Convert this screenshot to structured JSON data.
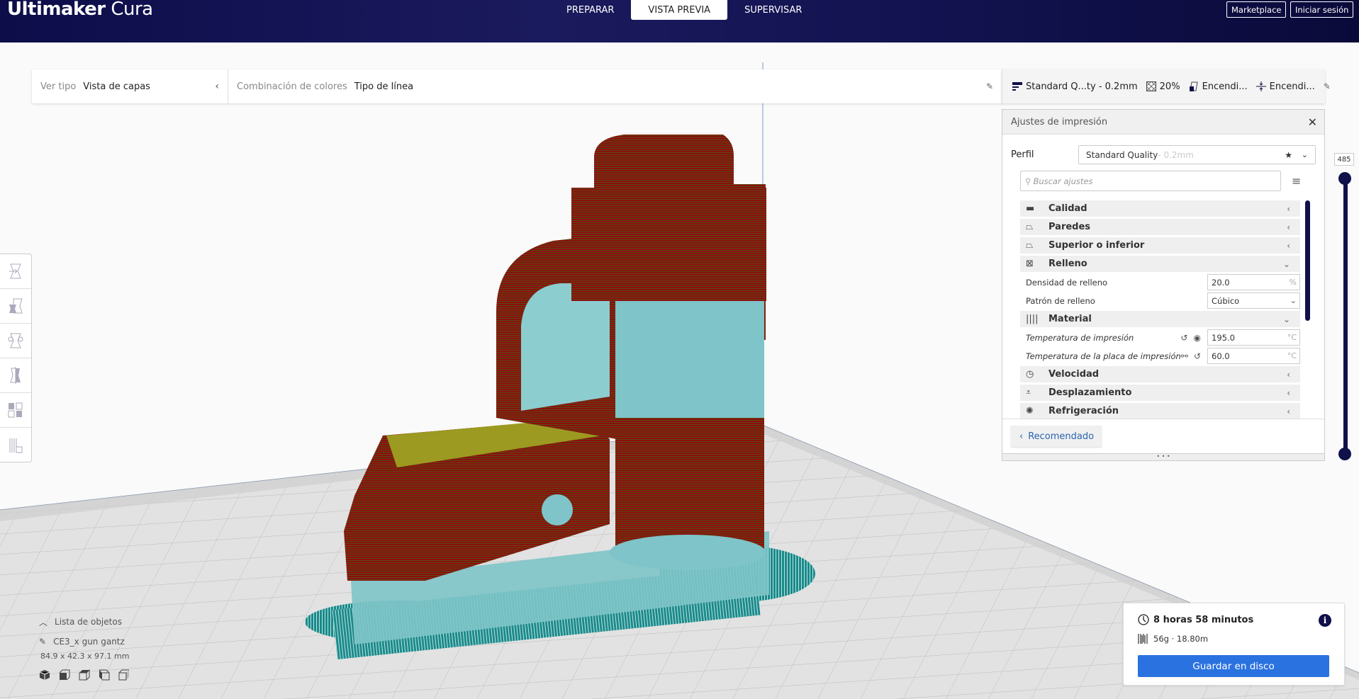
{
  "app": {
    "title_bold": "Ultimaker",
    "title_light": "Cura"
  },
  "stages": [
    {
      "label": "PREPARAR",
      "active": false
    },
    {
      "label": "VISTA PREVIA",
      "active": true
    },
    {
      "label": "SUPERVISAR",
      "active": false
    }
  ],
  "header_buttons": {
    "marketplace": "Marketplace",
    "login": "Iniciar sesión"
  },
  "view_bar": {
    "view_type_label": "Ver tipo",
    "view_type_value": "Vista de capas",
    "color_scheme_label": "Combinación de colores",
    "color_scheme_value": "Tipo de línea"
  },
  "settings_bar": {
    "profile": "Standard Q...ty - 0.2mm",
    "infill": "20%",
    "support": "Encendi...",
    "adhesion": "Encendi..."
  },
  "print_settings": {
    "title": "Ajustes de impresión",
    "profile_label": "Perfil",
    "profile_name": "Standard Quality",
    "profile_suffix": " - 0.2mm",
    "search_placeholder": "Buscar ajustes",
    "categories": {
      "calidad": "Calidad",
      "paredes": "Paredes",
      "superior": "Superior o inferior",
      "relleno": "Relleno",
      "material": "Material",
      "velocidad": "Velocidad",
      "desplazamiento": "Desplazamiento",
      "refrigeracion": "Refrigeración"
    },
    "settings": {
      "infill_density": {
        "label": "Densidad de relleno",
        "value": "20.0",
        "unit": "%"
      },
      "infill_pattern": {
        "label": "Patrón de relleno",
        "value": "Cúbico"
      },
      "print_temp": {
        "label": "Temperatura de impresión",
        "value": "195.0",
        "unit": "°C"
      },
      "bed_temp": {
        "label": "Temperatura de la placa de impresión",
        "value": "60.0",
        "unit": "°C"
      }
    },
    "recommended_button": "Recomendado"
  },
  "layer_slider": {
    "current_layer": "485"
  },
  "object_list": {
    "toggle_label": "Lista de objetos",
    "object_name": "CE3_x gun gantz",
    "dimensions": "84.9 x 42.3 x 97.1 mm"
  },
  "print_info": {
    "time": "8 horas 58 minutos",
    "material": "56g · 18.80m",
    "save_button": "Guardar en disco"
  },
  "colors": {
    "header_bg": "#1a1a5e",
    "accent_blue": "#2a72e0",
    "wall_red": "#8b0f0f",
    "support_cyan": "#7ec4c8",
    "skirt_teal": "#1a8a8a",
    "infill_yellow": "#b8b820"
  }
}
